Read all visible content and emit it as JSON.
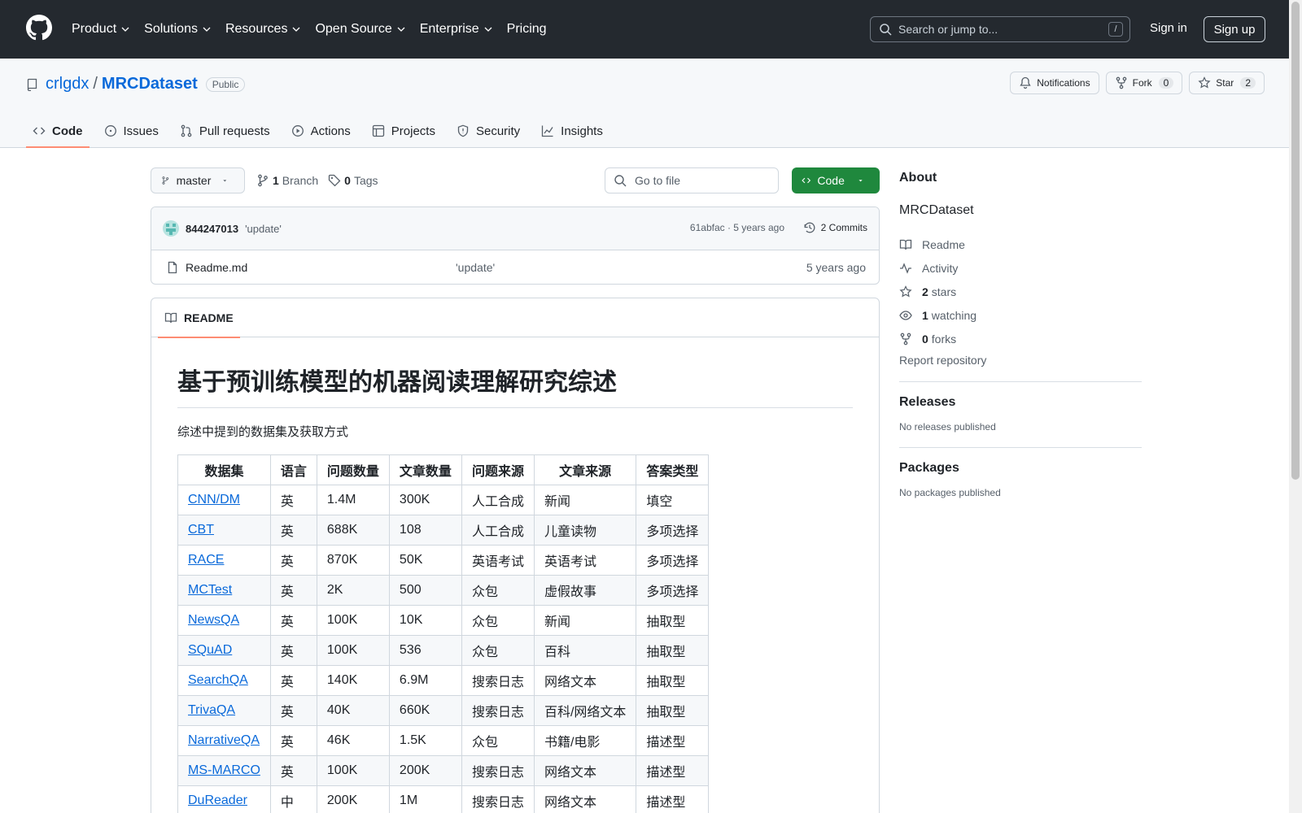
{
  "header": {
    "nav": [
      "Product",
      "Solutions",
      "Resources",
      "Open Source",
      "Enterprise",
      "Pricing"
    ],
    "search_placeholder": "Search or jump to...",
    "search_shortcut": "/",
    "sign_in": "Sign in",
    "sign_up": "Sign up"
  },
  "repo": {
    "owner": "crlgdx",
    "sep": "/",
    "name": "MRCDataset",
    "visibility": "Public",
    "notifications": "Notifications",
    "fork_label": "Fork",
    "fork_count": "0",
    "star_label": "Star",
    "star_count": "2",
    "tabs": [
      "Code",
      "Issues",
      "Pull requests",
      "Actions",
      "Projects",
      "Security",
      "Insights"
    ]
  },
  "toolbar": {
    "branch": "master",
    "branch_count": "1",
    "branch_label": "Branch",
    "tag_count": "0",
    "tag_label": "Tags",
    "go_to_file": "Go to file",
    "code_button": "Code"
  },
  "commit": {
    "user": "844247013",
    "message": "'update'",
    "meta": "61abfac · 5 years ago",
    "count": "2 Commits"
  },
  "files": [
    {
      "name": "Readme.md",
      "message": "'update'",
      "age": "5 years ago"
    }
  ],
  "readme": {
    "tab": "README",
    "title": "基于预训练模型的机器阅读理解研究综述",
    "intro": "综述中提到的数据集及获取方式",
    "table": {
      "headers": [
        "数据集",
        "语言",
        "问题数量",
        "文章数量",
        "问题来源",
        "文章来源",
        "答案类型"
      ],
      "rows": [
        [
          "CNN/DM",
          "英",
          "1.4M",
          "300K",
          "人工合成",
          "新闻",
          "填空"
        ],
        [
          "CBT",
          "英",
          "688K",
          "108",
          "人工合成",
          "儿童读物",
          "多项选择"
        ],
        [
          "RACE",
          "英",
          "870K",
          "50K",
          "英语考试",
          "英语考试",
          "多项选择"
        ],
        [
          "MCTest",
          "英",
          "2K",
          "500",
          "众包",
          "虚假故事",
          "多项选择"
        ],
        [
          "NewsQA",
          "英",
          "100K",
          "10K",
          "众包",
          "新闻",
          "抽取型"
        ],
        [
          "SQuAD",
          "英",
          "100K",
          "536",
          "众包",
          "百科",
          "抽取型"
        ],
        [
          "SearchQA",
          "英",
          "140K",
          "6.9M",
          "搜索日志",
          "网络文本",
          "抽取型"
        ],
        [
          "TrivaQA",
          "英",
          "40K",
          "660K",
          "搜索日志",
          "百科/网络文本",
          "抽取型"
        ],
        [
          "NarrativeQA",
          "英",
          "46K",
          "1.5K",
          "众包",
          "书籍/电影",
          "描述型"
        ],
        [
          "MS-MARCO",
          "英",
          "100K",
          "200K",
          "搜索日志",
          "网络文本",
          "描述型"
        ],
        [
          "DuReader",
          "中",
          "200K",
          "1M",
          "搜索日志",
          "网络文本",
          "描述型"
        ]
      ]
    }
  },
  "sidebar": {
    "about_title": "About",
    "description": "MRCDataset",
    "readme": "Readme",
    "activity": "Activity",
    "stars_count": "2",
    "stars_label": "stars",
    "watching_count": "1",
    "watching_label": "watching",
    "forks_count": "0",
    "forks_label": "forks",
    "report": "Report repository",
    "releases_title": "Releases",
    "releases_none": "No releases published",
    "packages_title": "Packages",
    "packages_none": "No packages published"
  }
}
